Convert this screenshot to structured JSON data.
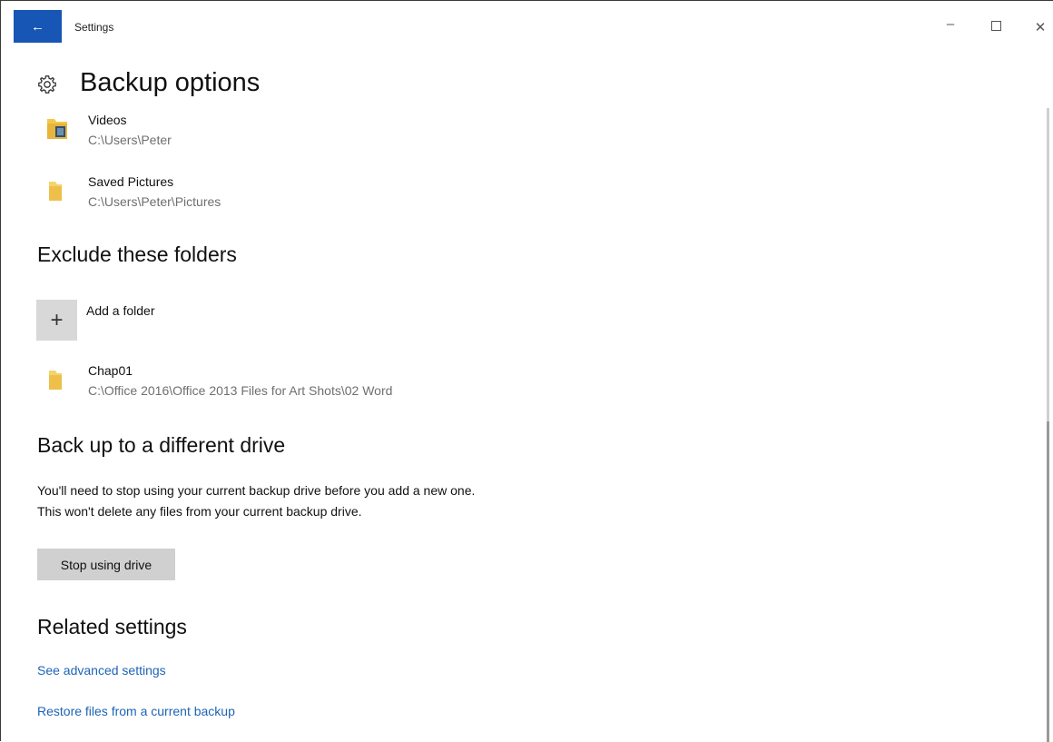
{
  "window": {
    "title": "Settings",
    "back_glyph": "←",
    "minimize_glyph": "–",
    "close_glyph": "✕"
  },
  "header": {
    "icon": "gear-icon",
    "title": "Backup options"
  },
  "included_folders": [
    {
      "name": "Videos",
      "path": "C:\\Users\\Peter",
      "icon": "videos-folder-icon"
    },
    {
      "name": "Saved Pictures",
      "path": "C:\\Users\\Peter\\Pictures",
      "icon": "folder-icon"
    }
  ],
  "exclude": {
    "heading": "Exclude these folders",
    "add_glyph": "+",
    "add_label": "Add a folder",
    "folders": [
      {
        "name": "Chap01",
        "path": "C:\\Office 2016\\Office 2013 Files for Art Shots\\02 Word",
        "icon": "folder-icon"
      }
    ]
  },
  "different_drive": {
    "heading": "Back up to a different drive",
    "description": "You'll need to stop using your current backup drive before you add a new one. This won't delete any files from your current backup drive.",
    "button_label": "Stop using drive"
  },
  "related": {
    "heading": "Related settings",
    "links": [
      "See advanced settings",
      "Restore files from a current backup"
    ]
  },
  "colors": {
    "accent": "#1756b5",
    "link": "#1d64b7",
    "folder": "#f2c94c"
  }
}
